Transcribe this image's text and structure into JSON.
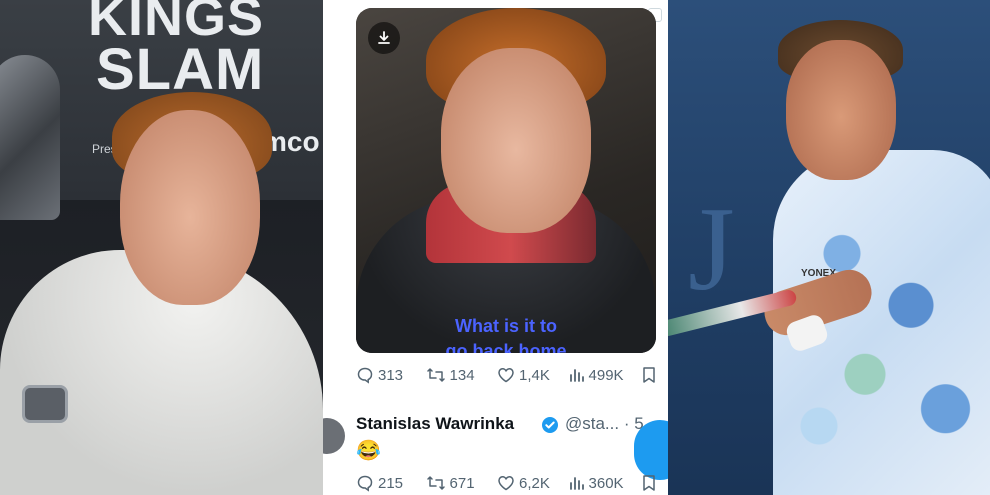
{
  "left_panel": {
    "banner_line1": "KINGS",
    "banner_line2": "SLAM",
    "banner_sponsor": "Pres",
    "banner_logo": "mco"
  },
  "tweet_video": {
    "caption_line1": "What is it to",
    "caption_line2": "go back home",
    "download_icon": "download-icon"
  },
  "tweet1_actions": {
    "replies": "313",
    "retweets": "134",
    "likes": "1,4K",
    "views": "499K"
  },
  "tweet2": {
    "display_name": "Stanislas Wawrinka",
    "handle": "@sta...",
    "time_suffix": "· 5",
    "emoji": "😂"
  },
  "tweet2_actions": {
    "replies": "215",
    "retweets": "671",
    "likes": "6,2K",
    "views": "360K"
  },
  "right_panel": {
    "background_letters": "J",
    "shirt_brand": "YONEX"
  },
  "colors": {
    "twitter_blue": "#1d9bf0",
    "action_gray": "#536471",
    "caption_blue": "#4b63ff",
    "court_blue": "#24456e"
  }
}
